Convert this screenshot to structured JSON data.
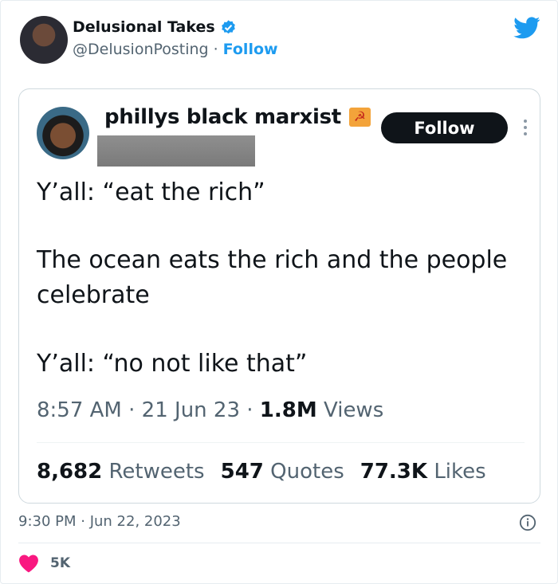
{
  "outer": {
    "display_name": "Delusional Takes",
    "handle": "@DelusionPosting",
    "separator": "·",
    "follow_label": "Follow",
    "timestamp": "9:30 PM · Jun 22, 2023",
    "like_count": "5K"
  },
  "inner": {
    "display_name": "phillys black marxist",
    "flag_glyph": "☭",
    "follow_label": "Follow",
    "lines": [
      "Y’all: “eat the rich”",
      "The ocean eats the rich and the people celebrate",
      "Y’all: “no not like that”"
    ],
    "meta": {
      "time": "8:57 AM",
      "date": "21 Jun 23",
      "views_value": "1.8M",
      "views_label": "Views",
      "sep": "·"
    },
    "stats": {
      "retweets_value": "8,682",
      "retweets_label": "Retweets",
      "quotes_value": "547",
      "quotes_label": "Quotes",
      "likes_value": "77.3K",
      "likes_label": "Likes"
    }
  },
  "icons": {
    "verified": "verified-badge-icon",
    "twitter": "twitter-bird-icon",
    "more": "more-options-icon",
    "info": "info-icon",
    "heart": "heart-icon"
  },
  "colors": {
    "twitter_blue": "#1d9bf0",
    "text_primary": "#0f1419",
    "text_secondary": "#536471",
    "heart_red": "#f91880",
    "flag_orange": "#f3a33a"
  }
}
